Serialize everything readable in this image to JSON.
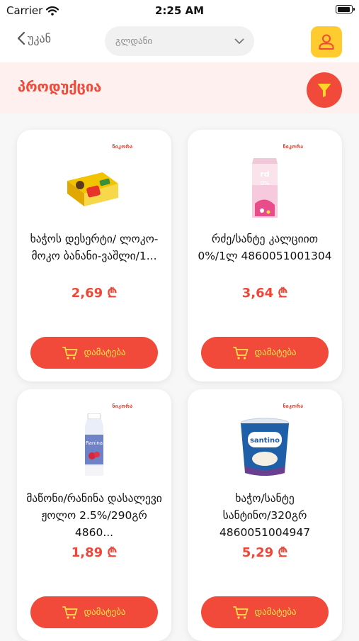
{
  "status_bar": {
    "carrier": "Carrier",
    "time": "2:25 AM"
  },
  "nav": {
    "back_label": "უკან",
    "location_value": "გლდანი"
  },
  "products_title": "პროდუქცია",
  "brand_label": "ნიკორა",
  "add_label": "დამატება",
  "colors": {
    "accent": "#f14a3a",
    "profile": "#ffcb2e",
    "header_bg": "#fdf0ee"
  },
  "icons": [
    "wifi-icon",
    "battery-icon",
    "chevron-left-icon",
    "chevron-down-icon",
    "user-icon",
    "filter-icon",
    "cart-icon"
  ],
  "products": [
    {
      "name": "ხაჭოს დესერტი/ ლოკო-მოკო ბანანი-ვაშლი/1...",
      "price": "2,69 ₾"
    },
    {
      "name": "რძე/სანტე კალციით 0%/1ლ 4860051001304",
      "price": "3,64 ₾"
    },
    {
      "name": "მაწონი/რანინა დასალევი ჟოლო 2.5%/290გრ 4860...",
      "price": "1,89 ₾"
    },
    {
      "name": "ხაჭო/სანტე სანტინო/320გრ 4860051004947",
      "price": "5,29 ₾"
    }
  ]
}
